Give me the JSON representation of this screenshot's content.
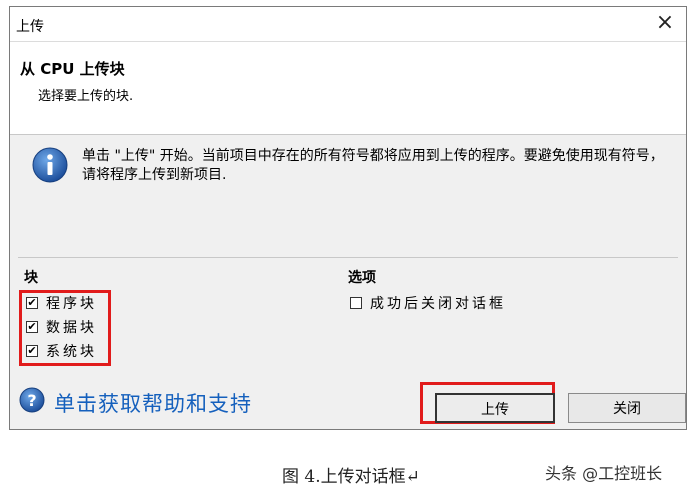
{
  "dialog": {
    "title": "上传",
    "close_glyph": "×",
    "header_title": "从 CPU 上传块",
    "header_subtitle": "选择要上传的块."
  },
  "info": {
    "icon": "info-icon",
    "text": "单击 \"上传\" 开始。当前项目中存在的所有符号都将应用到上传的程序。要避免使用现有符号，请将程序上传到新项目."
  },
  "blocks": {
    "title": "块",
    "items": [
      {
        "label": "程序块",
        "checked": true
      },
      {
        "label": "数据块",
        "checked": true
      },
      {
        "label": "系统块",
        "checked": true
      }
    ]
  },
  "options": {
    "title": "选项",
    "items": [
      {
        "label": "成功后关闭对话框",
        "checked": false
      }
    ]
  },
  "help": {
    "icon": "help-icon",
    "text": "单击获取帮助和支持"
  },
  "buttons": {
    "upload": "上传",
    "close": "关闭"
  },
  "caption": "图 4.上传对话框↵",
  "watermark": "头条 @工控班长",
  "colors": {
    "highlight": "#e11b1b",
    "link": "#1560bd"
  }
}
